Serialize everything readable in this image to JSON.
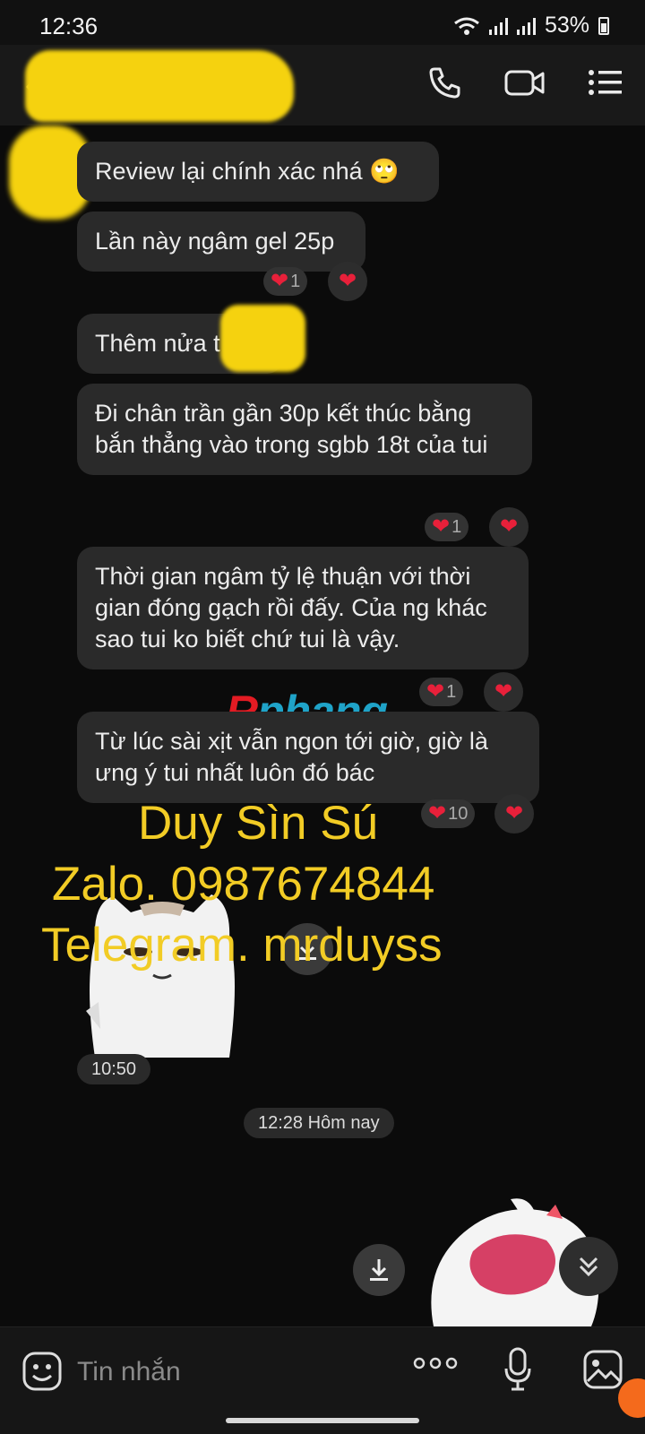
{
  "status_bar": {
    "time": "12:36",
    "battery": "53%"
  },
  "header": {
    "back_icon": "chevron-left-icon",
    "call_icon": "phone-icon",
    "video_icon": "video-icon",
    "menu_icon": "list-icon"
  },
  "messages": [
    {
      "text": "Review lại chính xác nhá 🙄"
    },
    {
      "text": "Lần này ngâm gel 25p",
      "reaction_count": "1"
    },
    {
      "text": "Thêm nửa t"
    },
    {
      "text": "Đi chân trần gần 30p kết thúc bằng bắn thẳng vào trong sgbb 18t của tui",
      "reaction_count": "1"
    },
    {
      "text": "Thời gian ngâm tỷ lệ thuận với thời gian đóng gạch rồi đấy. Của ng khác sao tui ko biết chứ tui là vậy.",
      "reaction_count": "1"
    },
    {
      "text": "Từ lúc sài xịt vẫn ngon tới giờ, giờ là ưng ý tui nhất luôn đó bác",
      "reaction_count": "10"
    }
  ],
  "watermark": {
    "part1": "R",
    "part2": "phang"
  },
  "promo": {
    "line1": "Duy Sìn Sú",
    "line2": "Zalo. 0987674844",
    "line3": "Telegram. mrduyss"
  },
  "sticker_time": "10:50",
  "date_separator": "12:28 Hôm nay",
  "input": {
    "placeholder": "Tin nhắn"
  },
  "colors": {
    "bubble": "#2a2a2a",
    "heart": "#e8203a",
    "promo": "#f2cc25",
    "mask": "#f5d20f"
  }
}
